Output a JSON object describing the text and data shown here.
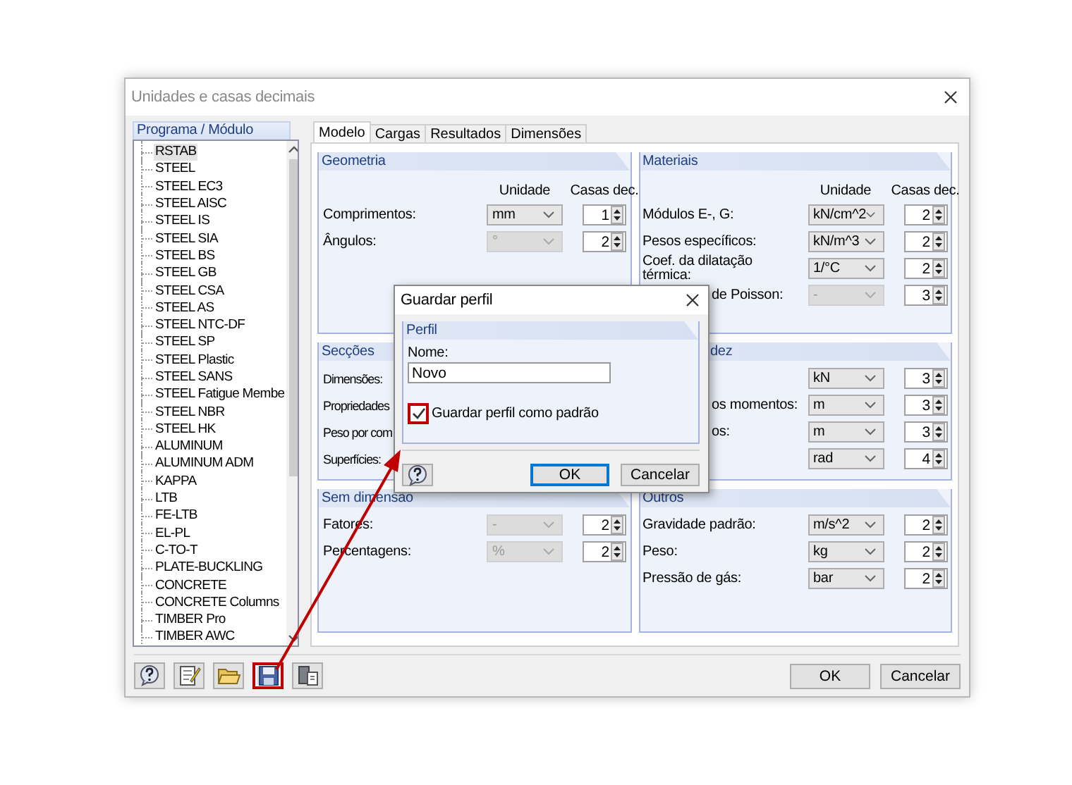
{
  "window": {
    "title": "Unidades e casas decimais"
  },
  "module_panel": {
    "header": "Programa / Módulo",
    "items": [
      {
        "label": "RSTAB",
        "selected": true
      },
      {
        "label": "STEEL",
        "selected": false
      },
      {
        "label": "STEEL EC3",
        "selected": false
      },
      {
        "label": "STEEL AISC",
        "selected": false
      },
      {
        "label": "STEEL IS",
        "selected": false
      },
      {
        "label": "STEEL SIA",
        "selected": false
      },
      {
        "label": "STEEL BS",
        "selected": false
      },
      {
        "label": "STEEL GB",
        "selected": false
      },
      {
        "label": "STEEL CSA",
        "selected": false
      },
      {
        "label": "STEEL AS",
        "selected": false
      },
      {
        "label": "STEEL NTC-DF",
        "selected": false
      },
      {
        "label": "STEEL SP",
        "selected": false
      },
      {
        "label": "STEEL Plastic",
        "selected": false
      },
      {
        "label": "STEEL SANS",
        "selected": false
      },
      {
        "label": "STEEL Fatigue Membe",
        "selected": false
      },
      {
        "label": "STEEL NBR",
        "selected": false
      },
      {
        "label": "STEEL HK",
        "selected": false
      },
      {
        "label": "ALUMINUM",
        "selected": false
      },
      {
        "label": "ALUMINUM ADM",
        "selected": false
      },
      {
        "label": "KAPPA",
        "selected": false
      },
      {
        "label": "LTB",
        "selected": false
      },
      {
        "label": "FE-LTB",
        "selected": false
      },
      {
        "label": "EL-PL",
        "selected": false
      },
      {
        "label": "C-TO-T",
        "selected": false
      },
      {
        "label": "PLATE-BUCKLING",
        "selected": false
      },
      {
        "label": "CONCRETE",
        "selected": false
      },
      {
        "label": "CONCRETE Columns",
        "selected": false
      },
      {
        "label": "TIMBER Pro",
        "selected": false
      },
      {
        "label": "TIMBER AWC",
        "selected": false
      }
    ]
  },
  "tabs": [
    {
      "label": "Modelo",
      "selected": true
    },
    {
      "label": "Cargas",
      "selected": false
    },
    {
      "label": "Resultados",
      "selected": false
    },
    {
      "label": "Dimensões",
      "selected": false
    }
  ],
  "left_groups": [
    {
      "title": "Geometria",
      "headers": [
        "Unidade",
        "Casas dec."
      ],
      "rows": [
        {
          "label": "Comprimentos:",
          "unit": "mm",
          "unit_disabled": false,
          "decimals": "1"
        },
        {
          "label": "Ângulos:",
          "unit": "°",
          "unit_disabled": true,
          "decimals": "2"
        }
      ]
    },
    {
      "title": "Secções",
      "rows": [
        {
          "label": "Dimensões:"
        },
        {
          "label": "Propriedades"
        },
        {
          "label": "Peso por com"
        },
        {
          "label": "Superfícies:"
        }
      ]
    },
    {
      "title": "Sem dimensão",
      "rows": [
        {
          "label": "Fatores:",
          "unit": "-",
          "unit_disabled": true,
          "decimals": "2"
        },
        {
          "label": "Percentagens:",
          "unit": "%",
          "unit_disabled": true,
          "decimals": "2"
        }
      ]
    }
  ],
  "right_groups": [
    {
      "title": "Materiais",
      "headers": [
        "Unidade",
        "Casas dec."
      ],
      "rows": [
        {
          "label": "Módulos E-, G:",
          "unit": "kN/cm^2",
          "unit_disabled": false,
          "decimals": "2"
        },
        {
          "label": "Pesos específicos:",
          "unit": "kN/m^3",
          "unit_disabled": false,
          "decimals": "2"
        },
        {
          "label": "Coef. da dilatação térmica:",
          "unit": "1/°C",
          "unit_disabled": false,
          "decimals": "2"
        },
        {
          "label": "de Poisson:",
          "partly_hidden": true,
          "unit": "-",
          "unit_disabled": true,
          "decimals": "3"
        }
      ]
    },
    {
      "title": "dez",
      "title_partly_hidden": true,
      "rows": [
        {
          "unit": "kN",
          "unit_disabled": false,
          "decimals": "3"
        },
        {
          "label": "os momentos:",
          "partly_hidden": true,
          "unit": "m",
          "unit_disabled": false,
          "decimals": "3"
        },
        {
          "label": "os:",
          "partly_hidden": true,
          "unit": "m",
          "unit_disabled": false,
          "decimals": "3"
        },
        {
          "unit": "rad",
          "unit_disabled": false,
          "decimals": "4"
        }
      ]
    },
    {
      "title": "Outros",
      "rows": [
        {
          "label": "Gravidade padrão:",
          "unit": "m/s^2",
          "unit_disabled": false,
          "decimals": "2"
        },
        {
          "label": "Peso:",
          "unit": "kg",
          "unit_disabled": false,
          "decimals": "2"
        },
        {
          "label": "Pressão de gás:",
          "unit": "bar",
          "unit_disabled": false,
          "decimals": "2"
        }
      ]
    }
  ],
  "toolbar": [
    {
      "kind": "help",
      "highlighted": false
    },
    {
      "kind": "edit",
      "highlighted": false
    },
    {
      "kind": "open",
      "highlighted": false
    },
    {
      "kind": "save",
      "highlighted": true
    },
    {
      "kind": "export",
      "highlighted": false
    }
  ],
  "buttons": [
    "OK",
    "Cancelar"
  ],
  "save_dialog": {
    "title": "Guardar perfil",
    "group": "Perfil",
    "name_label": "Nome:",
    "name_value": "Novo",
    "default_checkbox": {
      "label": "Guardar perfil como padrão",
      "checked": true,
      "highlighted": true
    },
    "buttons": [
      "OK",
      "Cancelar"
    ]
  }
}
